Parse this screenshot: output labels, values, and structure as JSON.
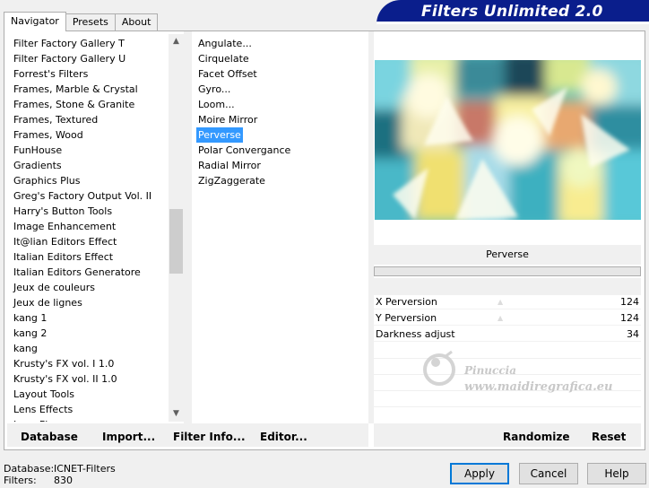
{
  "tabs": [
    {
      "label": "Navigator",
      "active": true
    },
    {
      "label": "Presets",
      "active": false
    },
    {
      "label": "About",
      "active": false
    }
  ],
  "banner": {
    "title": "Filters Unlimited 2.0"
  },
  "categories": [
    "Filter Factory Gallery T",
    "Filter Factory Gallery U",
    "Forrest's Filters",
    "Frames, Marble & Crystal",
    "Frames, Stone & Granite",
    "Frames, Textured",
    "Frames, Wood",
    "FunHouse",
    "Gradients",
    "Graphics Plus",
    "Greg's Factory Output Vol. II",
    "Harry's Button Tools",
    "Image Enhancement",
    "It@lian Editors Effect",
    "Italian Editors Effect",
    "Italian Editors Generatore",
    "Jeux de couleurs",
    "Jeux de lignes",
    "kang 1",
    "kang 2",
    "kang",
    "Krusty's FX vol. I 1.0",
    "Krusty's FX vol. II 1.0",
    "Layout Tools",
    "Lens Effects",
    "Lens Flares"
  ],
  "filters": [
    "Angulate...",
    "Cirquelate",
    "Facet Offset",
    "Gyro...",
    "Loom...",
    "Moire Mirror",
    "Perverse",
    "Polar Convergance",
    "Radial Mirror",
    "ZigZaggerate"
  ],
  "selected_filter_index": 6,
  "filter_name": "Perverse",
  "params": [
    {
      "label": "X Perversion",
      "value": "124"
    },
    {
      "label": "Y Perversion",
      "value": "124"
    },
    {
      "label": "Darkness adjust",
      "value": "34"
    }
  ],
  "watermark": {
    "line1": "Pinuccia",
    "line2": "www.maidiregrafica.eu"
  },
  "toolbar_left": {
    "database": "Database",
    "import": "Import...",
    "filter_info": "Filter Info...",
    "editor": "Editor..."
  },
  "toolbar_right": {
    "randomize": "Randomize",
    "reset": "Reset"
  },
  "status": {
    "database_label": "Database:",
    "database_value": "ICNET-Filters",
    "filters_label": "Filters:",
    "filters_value": "830"
  },
  "dialog": {
    "apply": "Apply",
    "cancel": "Cancel",
    "help": "Help"
  },
  "colors": {
    "banner": "#0a1e8c",
    "selection": "#3399ff",
    "default_button": "#0078d7"
  },
  "icons": {
    "scroll_up": "chevron-up-icon",
    "scroll_down": "chevron-down-icon"
  }
}
